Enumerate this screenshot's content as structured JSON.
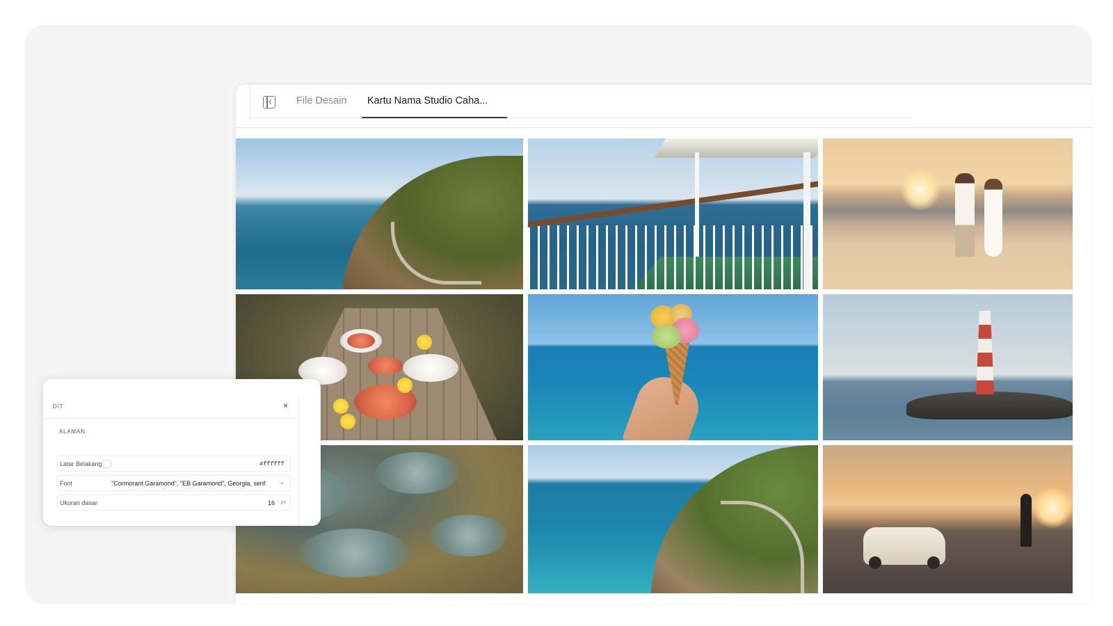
{
  "tabs": {
    "files": "File Desain",
    "active": "Kartu Nama Studio Caha..."
  },
  "gallery": {
    "images": [
      "coastal-cliff-road",
      "ferry-deck-sea-view",
      "couple-sunset-beach",
      "seafood-picnic-table",
      "ice-cream-over-sea",
      "red-white-lighthouse",
      "tide-pool-rocks",
      "winding-coast-road",
      "vintage-car-sunset"
    ]
  },
  "panel": {
    "title": "DIT",
    "close": "×",
    "section": "ALAMAN",
    "background": {
      "label": "Latar Belakang",
      "value": "#ffffff"
    },
    "font": {
      "label": "Font",
      "value": "\"Cormorant Garamond\", \"EB Garamond\", Georgia, serif",
      "chevron": "⌄"
    },
    "size": {
      "label": "Ukuran dasar",
      "value": "16",
      "unit": "px"
    }
  }
}
